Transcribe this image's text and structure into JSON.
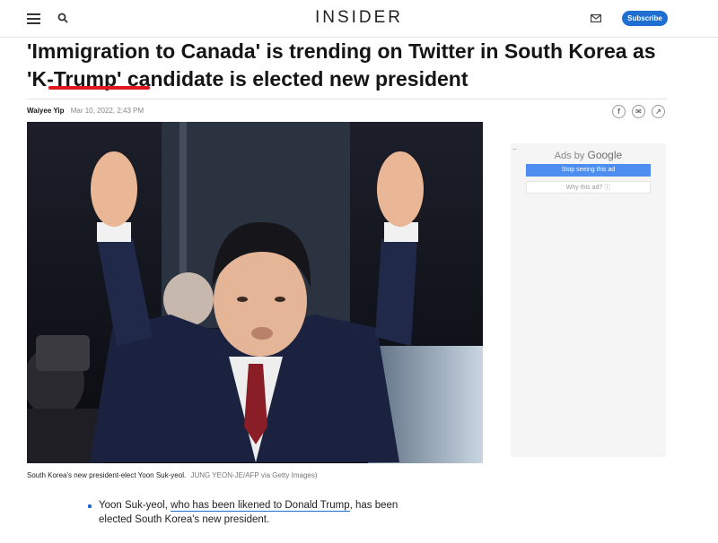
{
  "header": {
    "brand": "INSIDER",
    "subscribe_label": "Subscribe",
    "accent_color": "#1f6fd3"
  },
  "article": {
    "headline_part1": "'Immigration to Canada' is trending on Twitter in South Korea as ",
    "headline_highlight": "'K-Trump'",
    "headline_part2": " candidate is elected new president",
    "highlight_underline_color": "#e0181f",
    "author": "Waiyee Yip",
    "date": "Mar 10, 2022, 2:43 PM",
    "share_icons": [
      "facebook-icon",
      "email-icon",
      "share-icon"
    ],
    "caption": "South Korea's new president-elect Yoon Suk-yeol.",
    "photo_credit": "JUNG YEON-JE/AFP via Getty Images)",
    "bullet_text_before": "Yoon Suk-yeol, ",
    "bullet_link": "who has been likened to Donald Trump",
    "bullet_text_after": ", has been elected South Korea's new president."
  },
  "ad": {
    "label_prefix": "Ads by ",
    "label_brand": "Google",
    "stop_label": "Stop seeing this ad",
    "why_label": "Why this ad? ⓘ"
  }
}
